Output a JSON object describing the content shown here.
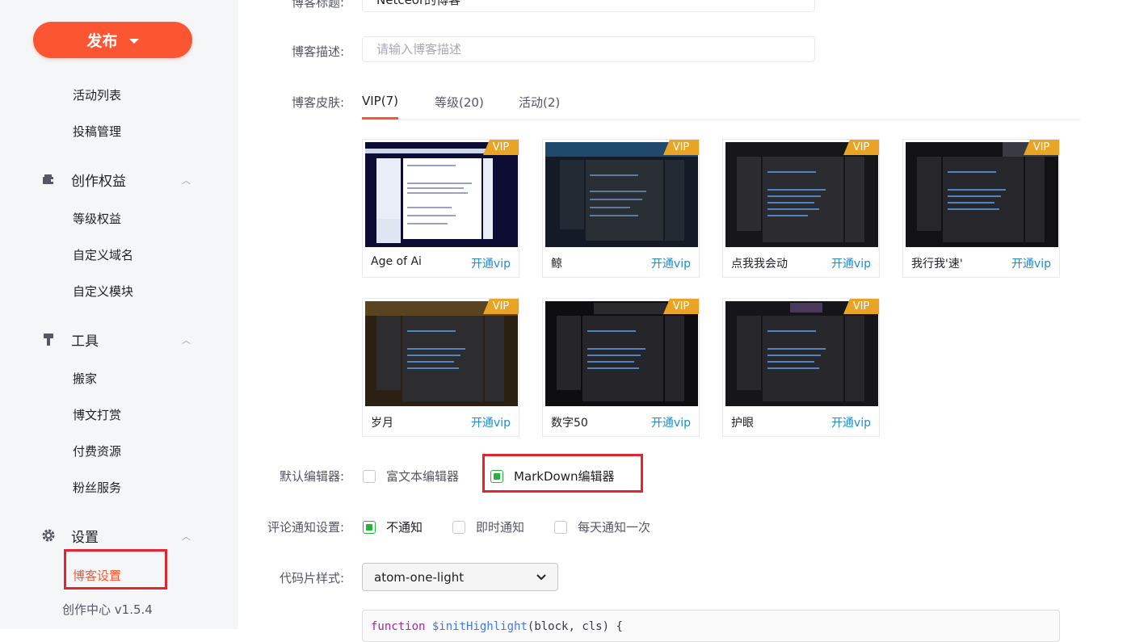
{
  "sidebar": {
    "publish_label": "发布",
    "items_top": [
      "活动列表",
      "投稿管理"
    ],
    "group_rights": "创作权益",
    "items_rights": [
      "等级权益",
      "自定义域名",
      "自定义模块"
    ],
    "group_tools": "工具",
    "items_tools": [
      "搬家",
      "博文打赏",
      "付费资源",
      "粉丝服务"
    ],
    "group_settings": "设置",
    "active_item": "博客设置",
    "version": "创作中心 v1.5.4"
  },
  "form": {
    "title_label": "博客标题:",
    "title_value": "Netceor的博客",
    "desc_label": "博客描述:",
    "desc_placeholder": "请输入博客描述",
    "skin_label": "博客皮肤:",
    "skin_tabs": [
      "VIP(7)",
      "等级(20)",
      "活动(2)"
    ],
    "skins": [
      {
        "name": "Age of Ai",
        "badge": "VIP",
        "action": "开通vip"
      },
      {
        "name": "鲸",
        "badge": "VIP",
        "action": "开通vip"
      },
      {
        "name": "点我我会动",
        "badge": "VIP",
        "action": "开通vip"
      },
      {
        "name": "我行我'速'",
        "badge": "VIP",
        "action": "开通vip"
      },
      {
        "name": "岁月",
        "badge": "VIP",
        "action": "开通vip"
      },
      {
        "name": "数字50",
        "badge": "VIP",
        "action": "开通vip"
      },
      {
        "name": "护眼",
        "badge": "VIP",
        "action": "开通vip"
      }
    ],
    "editor_label": "默认编辑器:",
    "editor_options": [
      {
        "label": "富文本编辑器",
        "checked": false
      },
      {
        "label": "MarkDown编辑器",
        "checked": true
      }
    ],
    "notify_label": "评论通知设置:",
    "notify_options": [
      {
        "label": "不通知",
        "checked": true
      },
      {
        "label": "即时通知",
        "checked": false
      },
      {
        "label": "每天通知一次",
        "checked": false
      }
    ],
    "code_label": "代码片样式:",
    "code_style_value": "atom-one-light",
    "code_sample_keyword": "function",
    "code_sample_fn": "$initHighlight",
    "code_sample_args": "(block, cls) {"
  },
  "colors": {
    "accent": "#fc5531",
    "check_green": "#27b23c",
    "vip_gold": "#e9a325",
    "link_blue": "#1a8ed1",
    "highlight_red": "#e3262d"
  }
}
